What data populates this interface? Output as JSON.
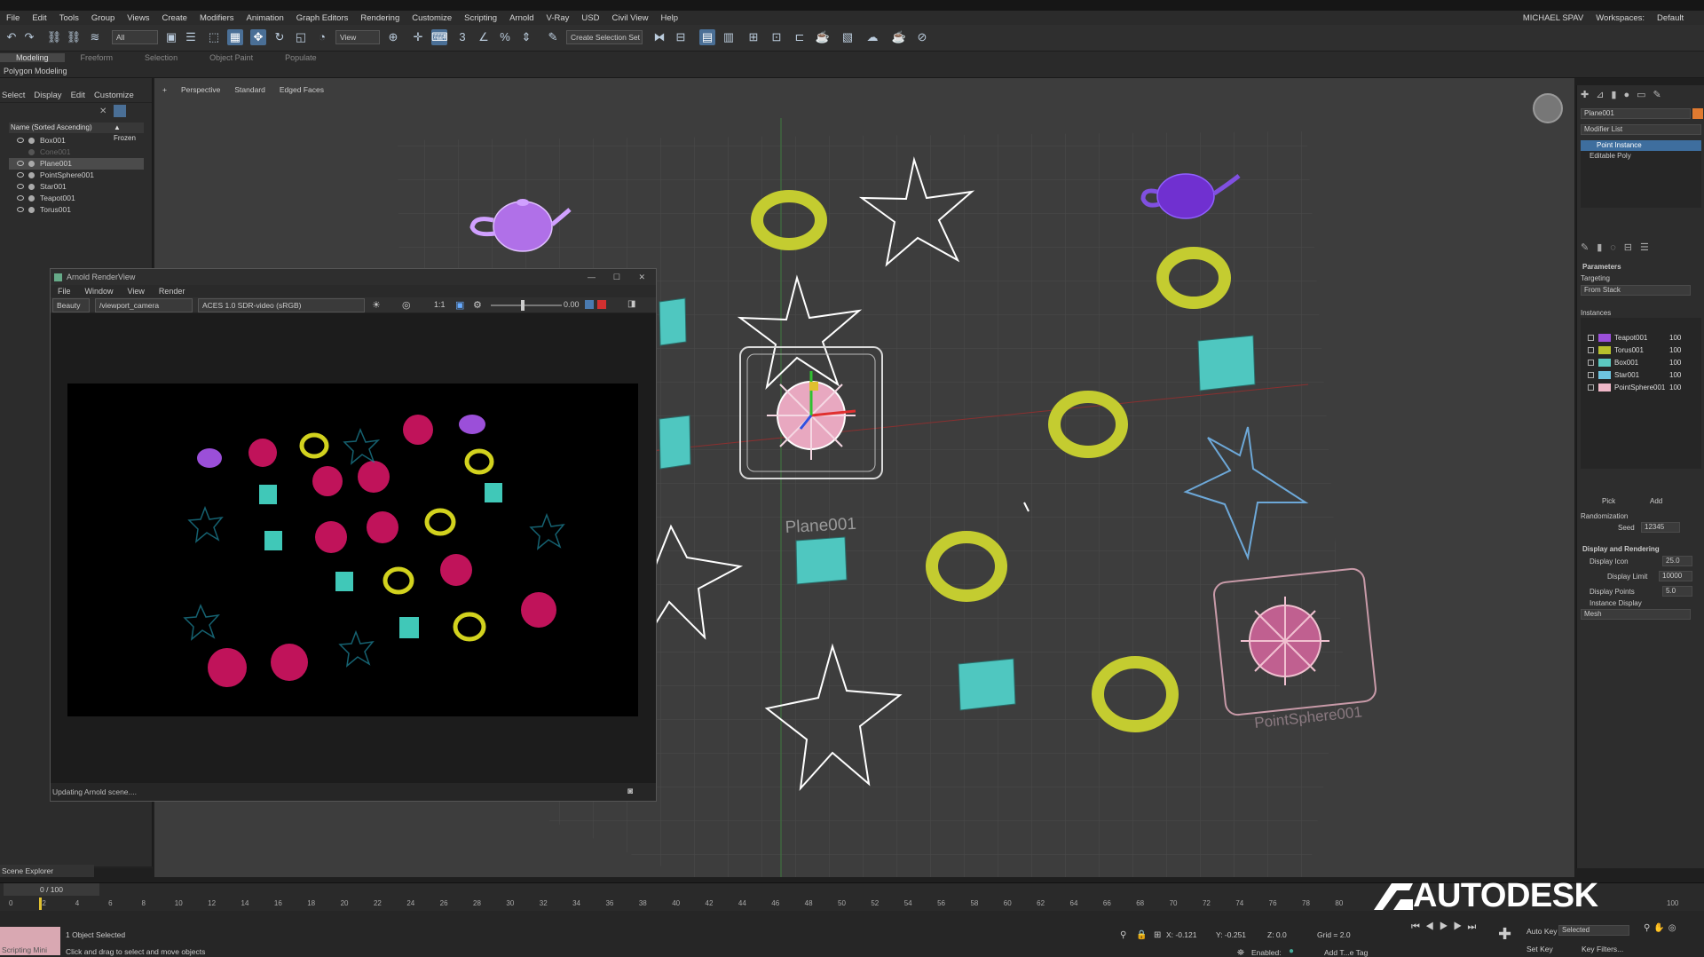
{
  "menu": [
    "File",
    "Edit",
    "Tools",
    "Group",
    "Views",
    "Create",
    "Modifiers",
    "Animation",
    "Graph Editors",
    "Rendering",
    "Customize",
    "Scripting",
    "Arnold",
    "V-Ray",
    "USD",
    "Civil View",
    "Help"
  ],
  "user": {
    "name": "MICHAEL SPAV",
    "workspaces_label": "Workspaces:",
    "workspace": "Default"
  },
  "toolbar": {
    "filter": "All",
    "view": "View",
    "selection_set": "Create Selection Set"
  },
  "ribbon": {
    "tabs": [
      "Modeling",
      "Freeform",
      "Selection",
      "Object Paint",
      "Populate"
    ],
    "active": "Modeling",
    "subtitle": "Polygon Modeling"
  },
  "explorer": {
    "menu": [
      "Select",
      "Display",
      "Edit",
      "Customize"
    ],
    "header": "Name (Sorted Ascending)",
    "frozen": "▲ Frozen",
    "items": [
      {
        "name": "Box001"
      },
      {
        "name": "Cone001"
      },
      {
        "name": "Plane001"
      },
      {
        "name": "PointSphere001"
      },
      {
        "name": "Star001"
      },
      {
        "name": "Teapot001"
      },
      {
        "name": "Torus001"
      }
    ],
    "footer": "Scene Explorer"
  },
  "viewport": {
    "labels": [
      "+",
      "Perspective",
      "Standard",
      "Edged Faces"
    ],
    "plane_label": "Plane001",
    "pointsphere_label": "PointSphere001"
  },
  "render_view": {
    "title": "Arnold RenderView",
    "menu": [
      "File",
      "Window",
      "View",
      "Render"
    ],
    "aov": "Beauty",
    "camera": "/viewport_camera",
    "colorspace": "ACES 1.0 SDR-video (sRGB)",
    "zoom": "1:1",
    "exposure": "0.00",
    "status": "Updating Arnold scene...."
  },
  "command_panel": {
    "object_name": "Plane001",
    "modifier_list": "Modifier List",
    "stack": [
      "Point Instance",
      "Editable Poly"
    ],
    "parameters": "Parameters",
    "targeting": "Targeting",
    "targeting_value": "From Stack",
    "instances_label": "Instances",
    "instances": [
      {
        "name": "Teapot001",
        "value": "100",
        "color": "#9b4fd9"
      },
      {
        "name": "Torus001",
        "value": "100",
        "color": "#b8c12c"
      },
      {
        "name": "Box001",
        "value": "100",
        "color": "#5cc8c0"
      },
      {
        "name": "Star001",
        "value": "100",
        "color": "#6ec4e0"
      },
      {
        "name": "PointSphere001",
        "value": "100",
        "color": "#f0b8c8"
      }
    ],
    "pick": "Pick",
    "add": "Add",
    "randomization": "Randomization",
    "seed_label": "Seed",
    "seed": "12345",
    "display_rendering": "Display and Rendering",
    "display_icon_label": "Display Icon",
    "display_icon": "25.0",
    "display_limit_label": "Display Limit",
    "display_limit": "10000",
    "display_points_label": "Display Points",
    "display_points": "5.0",
    "instance_display_label": "Instance Display",
    "instance_display": "Mesh"
  },
  "timeline": {
    "frame": "0 / 100",
    "ticks": [
      "0",
      "2",
      "4",
      "6",
      "8",
      "10",
      "12",
      "14",
      "16",
      "18",
      "20",
      "22",
      "24",
      "26",
      "28",
      "30",
      "32",
      "34",
      "36",
      "38",
      "40",
      "42",
      "44",
      "46",
      "48",
      "50",
      "52",
      "54",
      "56",
      "58",
      "60",
      "62",
      "64",
      "66",
      "68",
      "70",
      "72",
      "74",
      "76",
      "78",
      "80",
      "100"
    ]
  },
  "status": {
    "script_label": "Scripting Mini",
    "selected": "1 Object Selected",
    "hint": "Click and drag to select and move objects",
    "x": "X: -0.121",
    "y": "Y: -0.251",
    "z": "Z: 0.0",
    "grid": "Grid = 2.0",
    "enabled": "Enabled:",
    "add_tag": "Add T...e Tag",
    "auto_key": "Auto Key",
    "set_key": "Set Key",
    "selected_dd": "Selected",
    "key_filters": "Key Filters..."
  },
  "brand": "AUTODESK"
}
